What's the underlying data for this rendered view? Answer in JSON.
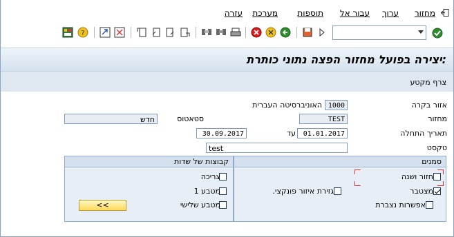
{
  "menu": {
    "items": [
      "מחזור",
      "ערוך",
      "עבור אל",
      "תוספות",
      "מערכת",
      "עזרה"
    ]
  },
  "toolbar": {
    "command_value": ""
  },
  "page": {
    "title": ":יצירה בפועל מחזור הפצה נתוני כותרת",
    "app_button": "צרף מקטע"
  },
  "form": {
    "area": {
      "label": "אזור בקרה",
      "value": "1000",
      "desc": "האוניברסיטה העברית"
    },
    "cycle": {
      "label": "מחזור",
      "value": "TEST",
      "status_label": "סטאטוס",
      "status_value": "חדש"
    },
    "start_date": {
      "label": "תאריך התחלה",
      "value": "01.01.2017",
      "to_label": "עד",
      "to_value": "30.09.2017"
    },
    "text": {
      "label": "טקסט",
      "value": "test"
    }
  },
  "flags": {
    "title": "סמנים",
    "items": [
      {
        "label": "חזור ושנה",
        "checked": false
      },
      {
        "label": "מצטבר",
        "checked": true
      },
      {
        "label": "גזירת איזור פונקצי.",
        "checked": false
      },
      {
        "label": "אפשרות נצברת",
        "checked": false
      }
    ]
  },
  "field_groups": {
    "title": "קבוצות של שדות",
    "items": [
      {
        "label": "צריכה",
        "checked": false
      },
      {
        "label": "מטבע 1",
        "checked": false
      },
      {
        "label": "מטבע שלישי",
        "checked": false
      }
    ],
    "button": "<<"
  }
}
